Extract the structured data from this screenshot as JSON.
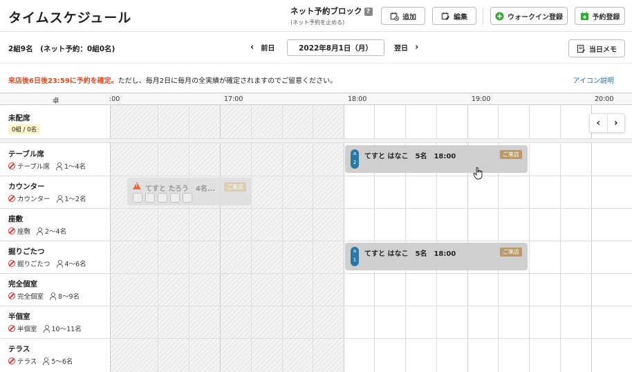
{
  "header": {
    "title": "タイムスケジュール",
    "net_block_label": "ネット予約ブロック",
    "net_block_help": "?",
    "net_block_sub": "(ネット予約を止める)",
    "add_label": "追加",
    "edit_label": "編集",
    "walkin_label": "ウォークイン登録",
    "reserve_label": "予約登録"
  },
  "subbar": {
    "count": "2組9名　(ネット予約：0組0名)",
    "prev_label": "前日",
    "date": "2022年8月1日（月）",
    "next_label": "翌日",
    "memo_label": "当日メモ"
  },
  "notice": {
    "highlight": "来店後6日後23:59に予約を確定。",
    "rest": "ただし、毎月2日に毎月の全実績が確定されますのでご留意ください。",
    "icon_link": "アイコン説明"
  },
  "grid": {
    "seat_col_header": "卓",
    "times": [
      ":00",
      "17:00",
      "18:00",
      "19:00",
      "20:00"
    ],
    "unassigned": {
      "name": "未配席",
      "count": "0組 / 0名"
    },
    "seats": [
      {
        "name": "テーブル席",
        "type": "テーブル席",
        "capacity": "1〜4名"
      },
      {
        "name": "カウンター",
        "type": "カウンター",
        "capacity": "1〜2名"
      },
      {
        "name": "座敷",
        "type": "座敷",
        "capacity": "2〜4名"
      },
      {
        "name": "掘りごたつ",
        "type": "掘りごたつ",
        "capacity": "4〜6名"
      },
      {
        "name": "完全個室",
        "type": "完全個室",
        "capacity": "8〜9名"
      },
      {
        "name": "半個室",
        "type": "半個室",
        "capacity": "10〜11名"
      },
      {
        "name": "テラス",
        "type": "テラス",
        "capacity": "5〜6名"
      }
    ]
  },
  "reservations": [
    {
      "name": "てすと はなこ　5名　18:00",
      "tag_top": "a",
      "tag_num": "2",
      "status": "ご来店"
    },
    {
      "name": "てすと たろう　4名...",
      "status": "ご来店"
    },
    {
      "name": "てすと はなこ　5名　18:00",
      "tag_top": "a",
      "tag_num": "1",
      "status": "ご来店"
    }
  ],
  "pager": {
    "prev": "‹",
    "next": "›"
  },
  "colors": {
    "accent_red": "#e04a1f",
    "link_blue": "#1a6fb5",
    "walkin_green": "#3aa53a",
    "visit_badge": "#b99b6b",
    "tag_blue": "#2a77a8"
  }
}
